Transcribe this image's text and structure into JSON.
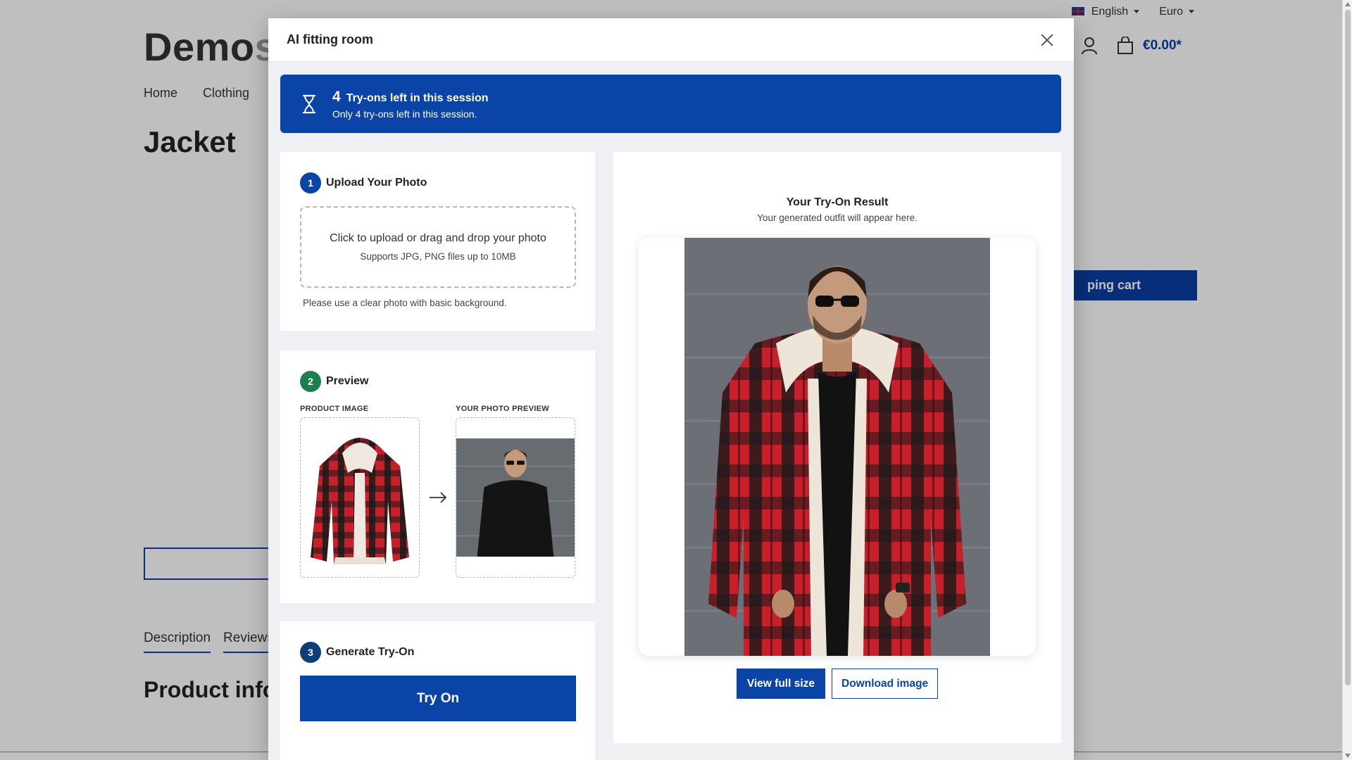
{
  "shop": {
    "language": "English",
    "currency": "Euro",
    "logo_main": "Demo",
    "logo_rest": "s",
    "cart_total": "€0.00*",
    "nav": [
      "Home",
      "Clothing"
    ],
    "product_title": "Jacket",
    "cart_button": "ping cart",
    "tabs": [
      "Description",
      "Reviews"
    ],
    "section_title": "Product info"
  },
  "modal": {
    "title": "AI fitting room",
    "banner": {
      "count": "4",
      "title": "Try-ons left in this session",
      "subtitle": "Only 4 try-ons left in this session."
    },
    "step1": {
      "number": "1",
      "title": "Upload Your Photo",
      "dropzone_main": "Click to upload or drag and drop your photo",
      "dropzone_sub": "Supports JPG, PNG files up to 10MB",
      "hint": "Please use a clear photo with basic background."
    },
    "step2": {
      "number": "2",
      "title": "Preview",
      "product_label": "PRODUCT IMAGE",
      "photo_label": "YOUR PHOTO PREVIEW"
    },
    "step3": {
      "number": "3",
      "title": "Generate Try-On",
      "button": "Try On"
    },
    "result": {
      "title": "Your Try-On Result",
      "subtitle": "Your generated outfit will appear here.",
      "view_button": "View full size",
      "download_button": "Download image"
    }
  },
  "colors": {
    "primary": "#0a44a6",
    "step2": "#1d7f4e",
    "jacket_red": "#c8202a",
    "jacket_dark": "#1a1a1a"
  }
}
